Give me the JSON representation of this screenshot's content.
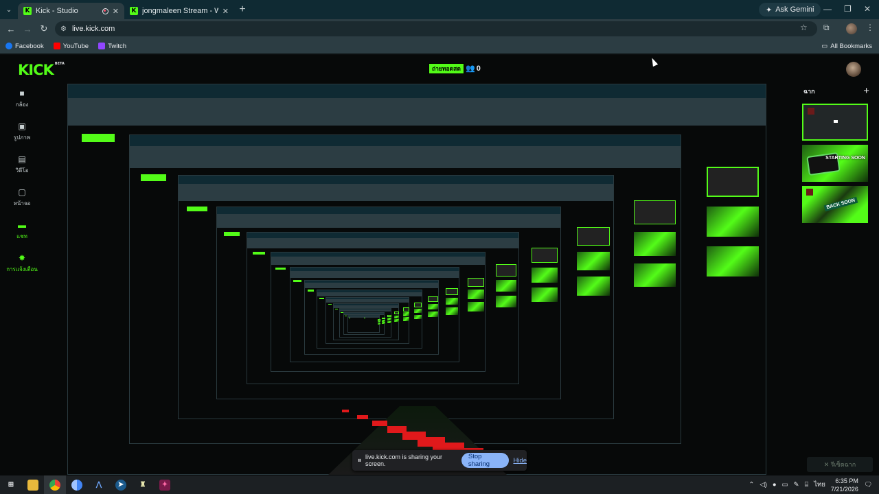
{
  "browser": {
    "tabs": [
      {
        "title": "Kick - Studio",
        "active": true
      },
      {
        "title": "jongmaleen Stream - Watch Li...",
        "active": false
      }
    ],
    "ask_gemini": "Ask Gemini",
    "url": "live.kick.com",
    "bookmarks": [
      {
        "label": "Facebook",
        "color": "#1877f2"
      },
      {
        "label": "YouTube",
        "color": "#ff0000"
      },
      {
        "label": "Twitch",
        "color": "#9146ff"
      }
    ],
    "all_bookmarks": "All Bookmarks"
  },
  "studio": {
    "logo": "KICK",
    "logo_badge": "BETA",
    "live_status": "ถ่ายทอดสด",
    "viewer_count": "0",
    "sidebar": [
      {
        "label": "กล้อง",
        "icon": "camera-icon",
        "active": false
      },
      {
        "label": "รูปภาพ",
        "icon": "image-icon",
        "active": false
      },
      {
        "label": "วิดีโอ",
        "icon": "film-icon",
        "active": false
      },
      {
        "label": "หน้าจอ",
        "icon": "screen-share-icon",
        "active": false
      },
      {
        "label": "แชท",
        "icon": "chat-icon",
        "active": true
      },
      {
        "label": "การแจ้งเตือน",
        "icon": "alert-icon",
        "active": true
      }
    ],
    "scenes_title": "ฉาก",
    "scene_labels": [
      "",
      "STARTING SOON",
      "BACK SOON"
    ],
    "end_scene_button": "✕ รีเซ็ตฉาก",
    "accent_color": "#53fc18"
  },
  "screen_share": {
    "message": "live.kick.com is sharing your screen.",
    "stop_label": "Stop sharing",
    "hide_label": "Hide"
  },
  "taskbar": {
    "language": "ไทย",
    "time": "6:35 PM",
    "date": "7/21/2026"
  }
}
